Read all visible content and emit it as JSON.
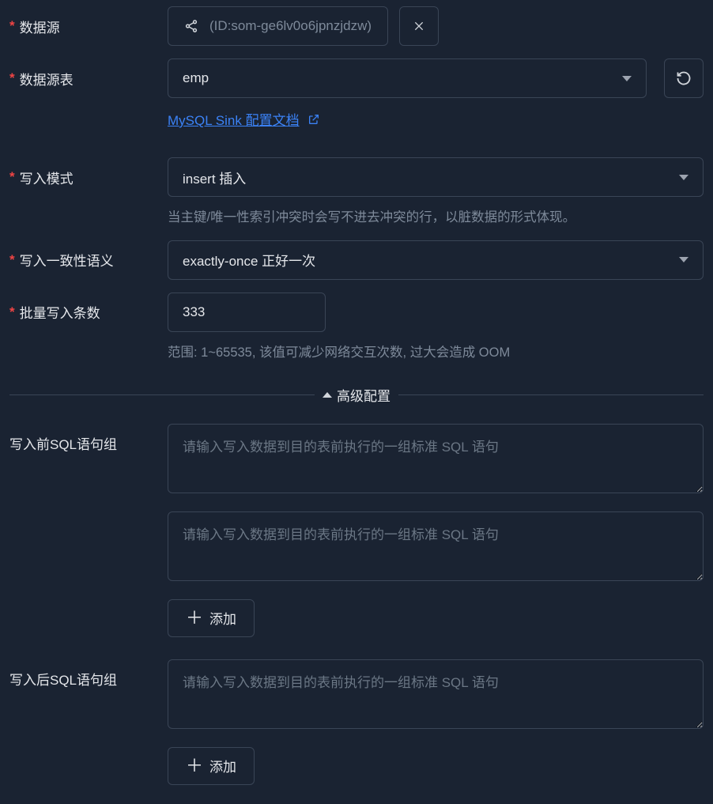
{
  "labels": {
    "datasource": "数据源",
    "table": "数据源表",
    "writeMode": "写入模式",
    "consistency": "写入一致性语义",
    "batchCount": "批量写入条数",
    "advanced": "高级配置",
    "preSql": "写入前SQL语句组",
    "postSql": "写入后SQL语句组"
  },
  "datasource": {
    "value": "(ID:som-ge6lv0o6jpnzjdzw)"
  },
  "table": {
    "selected": "emp"
  },
  "docLink": {
    "text": "MySQL Sink 配置文档"
  },
  "writeMode": {
    "selected": "insert 插入",
    "help": "当主键/唯一性索引冲突时会写不进去冲突的行，以脏数据的形式体现。"
  },
  "consistency": {
    "selected": "exactly-once 正好一次"
  },
  "batchCount": {
    "value": "333",
    "help": "范围: 1~65535, 该值可减少网络交互次数, 过大会造成 OOM"
  },
  "preSql": {
    "placeholder": "请输入写入数据到目的表前执行的一组标准 SQL 语句",
    "items": [
      "",
      ""
    ],
    "addLabel": "添加"
  },
  "postSql": {
    "placeholder": "请输入写入数据到目的表前执行的一组标准 SQL 语句",
    "items": [
      ""
    ],
    "addLabel": "添加"
  }
}
